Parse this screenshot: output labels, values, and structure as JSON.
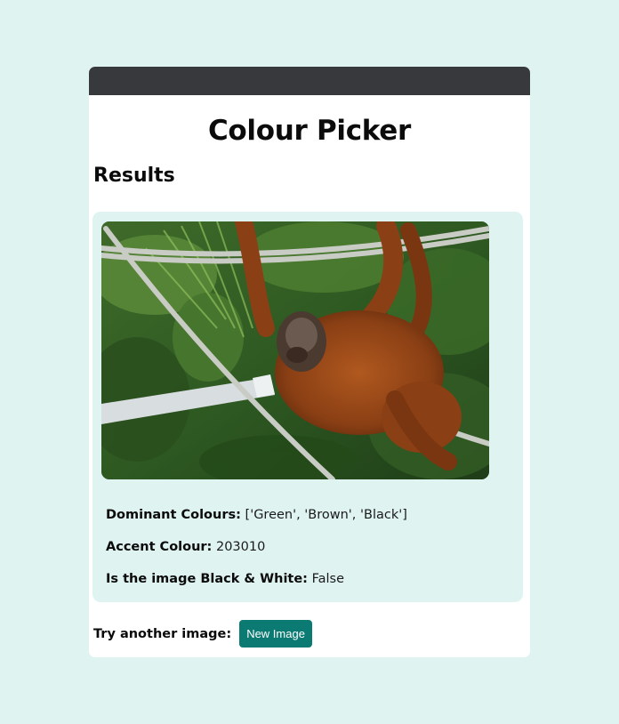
{
  "page": {
    "title": "Colour Picker",
    "results_heading": "Results"
  },
  "image": {
    "subject": "orangutan hanging from rope"
  },
  "results": {
    "dominant_label": "Dominant Colours:",
    "dominant_value": "['Green', 'Brown', 'Black']",
    "accent_label": "Accent Colour:",
    "accent_value": "203010",
    "bw_label": "Is the image Black & White:",
    "bw_value": "False"
  },
  "footer": {
    "label": "Try another image:",
    "button_label": "New Image"
  },
  "colors": {
    "background": "#dff4f1",
    "topbar": "#37393c",
    "button": "#0b7a72"
  }
}
